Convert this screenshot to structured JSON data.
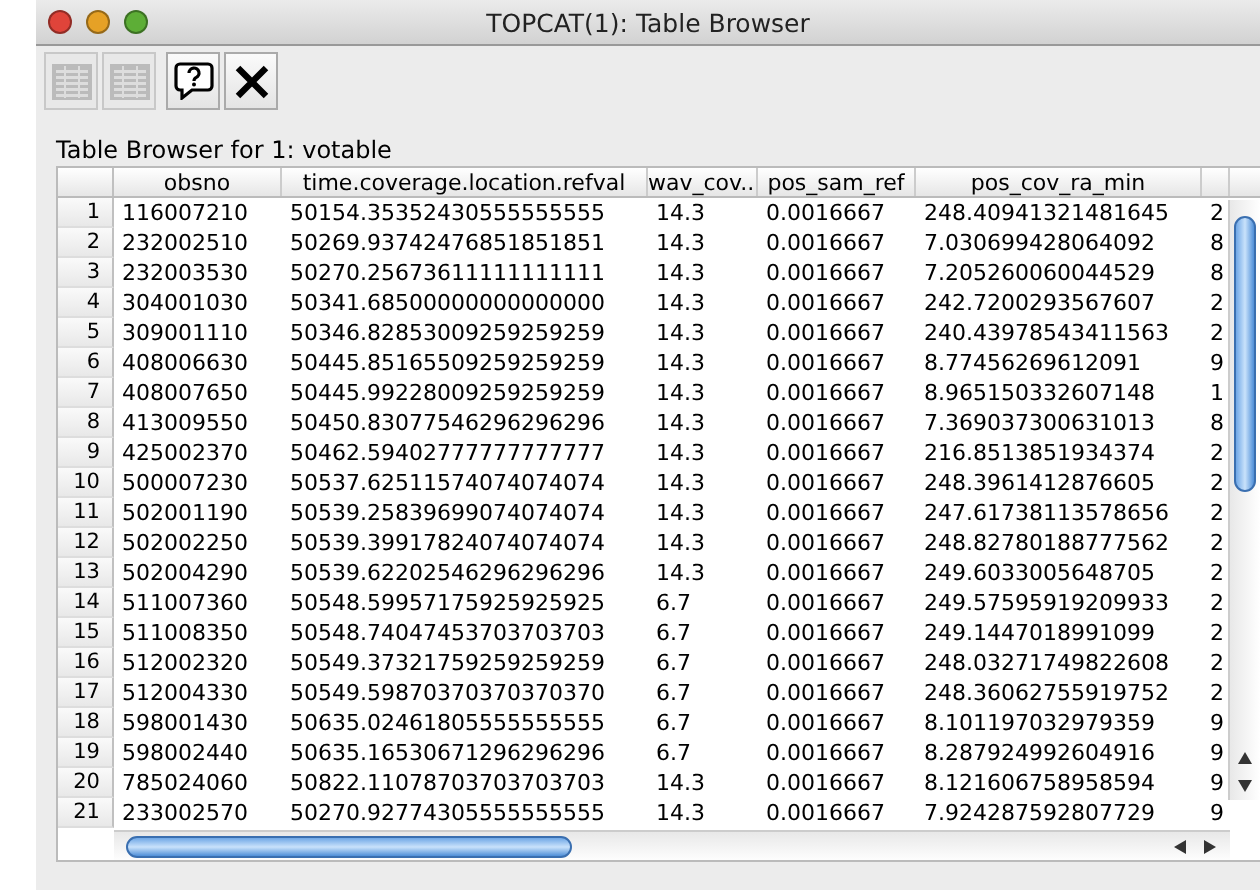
{
  "window": {
    "title": "TOPCAT(1): Table Browser"
  },
  "toolbar": [
    {
      "kind": "grid",
      "disabled": true
    },
    {
      "kind": "grid",
      "disabled": true
    },
    {
      "kind": "help",
      "disabled": false
    },
    {
      "kind": "close",
      "disabled": false
    }
  ],
  "caption": "Table Browser for 1: votable",
  "table": {
    "columns": [
      "obsno",
      "time.coverage.location.refval",
      "wav_cov...",
      "pos_sam_ref",
      "pos_cov_ra_min",
      ""
    ],
    "rows": [
      {
        "index": "1",
        "cells": [
          "116007210",
          "50154.35352430555555555",
          "14.3",
          "0.0016667",
          "248.40941321481645",
          "2"
        ]
      },
      {
        "index": "2",
        "cells": [
          "232002510",
          "50269.93742476851851851",
          "14.3",
          "0.0016667",
          "7.030699428064092",
          "8"
        ]
      },
      {
        "index": "3",
        "cells": [
          "232003530",
          "50270.25673611111111111",
          "14.3",
          "0.0016667",
          "7.205260060044529",
          "8"
        ]
      },
      {
        "index": "4",
        "cells": [
          "304001030",
          "50341.68500000000000000",
          "14.3",
          "0.0016667",
          "242.7200293567607",
          "2"
        ]
      },
      {
        "index": "5",
        "cells": [
          "309001110",
          "50346.82853009259259259",
          "14.3",
          "0.0016667",
          "240.43978543411563",
          "2"
        ]
      },
      {
        "index": "6",
        "cells": [
          "408006630",
          "50445.85165509259259259",
          "14.3",
          "0.0016667",
          "8.77456269612091",
          "9"
        ]
      },
      {
        "index": "7",
        "cells": [
          "408007650",
          "50445.99228009259259259",
          "14.3",
          "0.0016667",
          "8.965150332607148",
          "1"
        ]
      },
      {
        "index": "8",
        "cells": [
          "413009550",
          "50450.83077546296296296",
          "14.3",
          "0.0016667",
          "7.369037300631013",
          "8"
        ]
      },
      {
        "index": "9",
        "cells": [
          "425002370",
          "50462.59402777777777777",
          "14.3",
          "0.0016667",
          "216.8513851934374",
          "2"
        ]
      },
      {
        "index": "10",
        "cells": [
          "500007230",
          "50537.62511574074074074",
          "14.3",
          "0.0016667",
          "248.3961412876605",
          "2"
        ]
      },
      {
        "index": "11",
        "cells": [
          "502001190",
          "50539.25839699074074074",
          "14.3",
          "0.0016667",
          "247.61738113578656",
          "2"
        ]
      },
      {
        "index": "12",
        "cells": [
          "502002250",
          "50539.39917824074074074",
          "14.3",
          "0.0016667",
          "248.82780188777562",
          "2"
        ]
      },
      {
        "index": "13",
        "cells": [
          "502004290",
          "50539.62202546296296296",
          "14.3",
          "0.0016667",
          "249.6033005648705",
          "2"
        ]
      },
      {
        "index": "14",
        "cells": [
          "511007360",
          "50548.59957175925925925",
          "6.7",
          "0.0016667",
          "249.57595919209933",
          "2"
        ]
      },
      {
        "index": "15",
        "cells": [
          "511008350",
          "50548.74047453703703703",
          "6.7",
          "0.0016667",
          "249.1447018991099",
          "2"
        ]
      },
      {
        "index": "16",
        "cells": [
          "512002320",
          "50549.37321759259259259",
          "6.7",
          "0.0016667",
          "248.03271749822608",
          "2"
        ]
      },
      {
        "index": "17",
        "cells": [
          "512004330",
          "50549.59870370370370370",
          "6.7",
          "0.0016667",
          "248.36062755919752",
          "2"
        ]
      },
      {
        "index": "18",
        "cells": [
          "598001430",
          "50635.02461805555555555",
          "6.7",
          "0.0016667",
          "8.101197032979359",
          "9"
        ]
      },
      {
        "index": "19",
        "cells": [
          "598002440",
          "50635.16530671296296296",
          "6.7",
          "0.0016667",
          "8.287924992604916",
          "9"
        ]
      },
      {
        "index": "20",
        "cells": [
          "785024060",
          "50822.11078703703703703",
          "14.3",
          "0.0016667",
          "8.121606758958594",
          "9"
        ]
      },
      {
        "index": "21",
        "cells": [
          "233002570",
          "50270.92774305555555555",
          "14.3",
          "0.0016667",
          "7.924287592807729",
          "9"
        ]
      }
    ]
  }
}
